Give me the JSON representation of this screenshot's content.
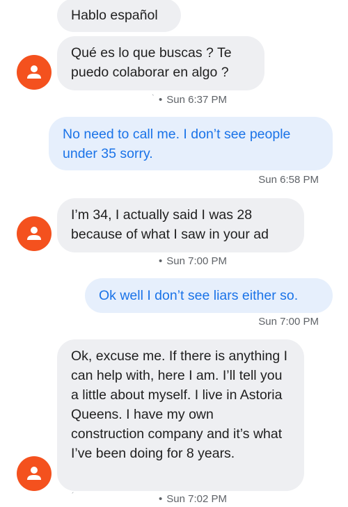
{
  "messages": [
    {
      "text": "Hablo español"
    },
    {
      "text": "Qué es lo que buscas ? Te puedo colaborar en algo ?"
    },
    {
      "text": "No need to call me. I don’t see people under 35 sorry."
    },
    {
      "text": "I’m 34, I actually said I was 28 because of what I saw in your ad"
    },
    {
      "text": "Ok well I don’t see liars either so."
    },
    {
      "text": "Ok, excuse me. If there is anything I can help with, here I am. I’ll tell you a little about myself. I live in Astoria Queens. I have my own construction company and it’s what I’ve been doing for 8 years."
    }
  ],
  "timestamps": {
    "t1": "Sun 6:37 PM",
    "t2": "Sun 6:58 PM",
    "t3": "Sun 7:00 PM",
    "t4": "Sun 7:00 PM",
    "t5": "Sun 7:02 PM"
  },
  "meta": {
    "dot": "•",
    "tick": "`",
    "tick2": "´"
  },
  "colors": {
    "incoming_bubble": "#eeeff2",
    "outgoing_bubble": "#e6effc",
    "outgoing_text": "#1a73e8",
    "avatar": "#f4511e"
  },
  "icons": {
    "avatar": "person-icon"
  }
}
